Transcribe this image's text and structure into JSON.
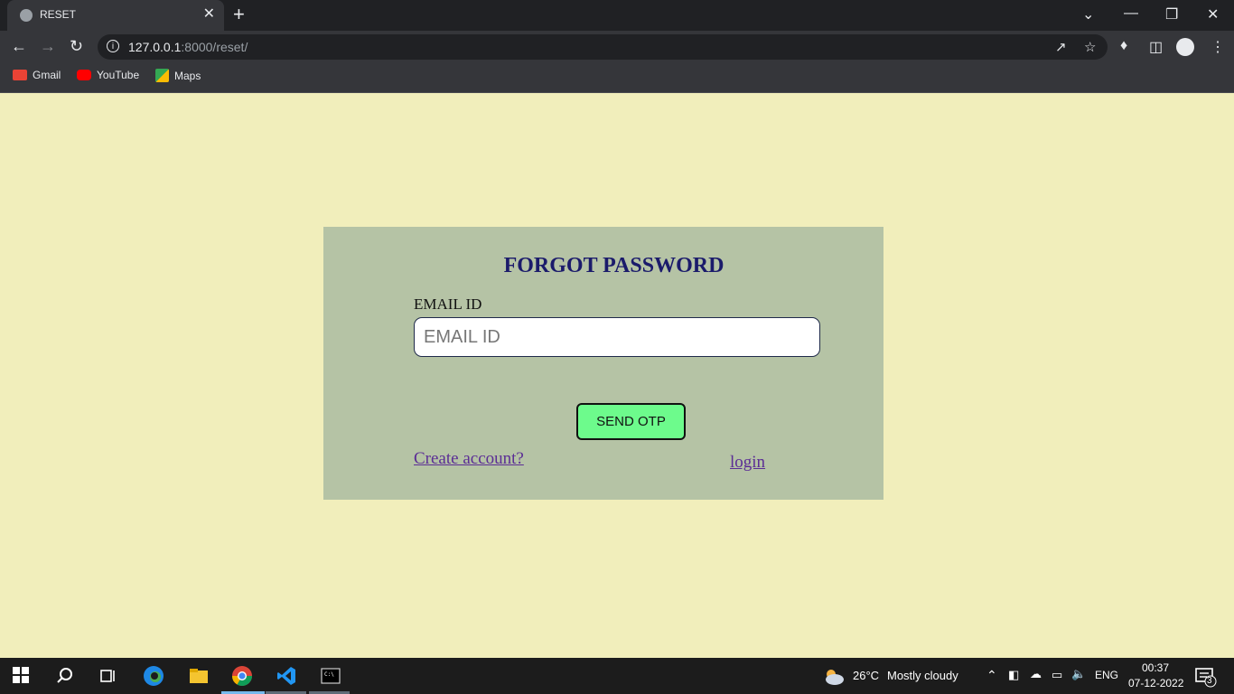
{
  "browser": {
    "tab_title": "RESET",
    "tab_close": "✕",
    "new_tab": "+",
    "url_host": "127.0.0.1",
    "url_rest": ":8000/reset/",
    "bookmarks": [
      "Gmail",
      "YouTube",
      "Maps"
    ]
  },
  "page": {
    "heading": "FORGOT PASSWORD",
    "email_label": "EMAIL ID",
    "email_placeholder": "EMAIL ID",
    "send_button": "SEND OTP",
    "create_link": "Create account?",
    "login_link": "login"
  },
  "taskbar": {
    "temperature": "26°C",
    "weather": "Mostly cloudy",
    "language": "ENG",
    "time": "00:37",
    "date": "07-12-2022",
    "notifications": "3"
  },
  "colors": {
    "page_bg": "#f1eebb",
    "card_bg": "#b5c3a5",
    "heading": "#1b1b6b",
    "button_bg": "#6dfb8c",
    "link": "#5b2d95"
  }
}
